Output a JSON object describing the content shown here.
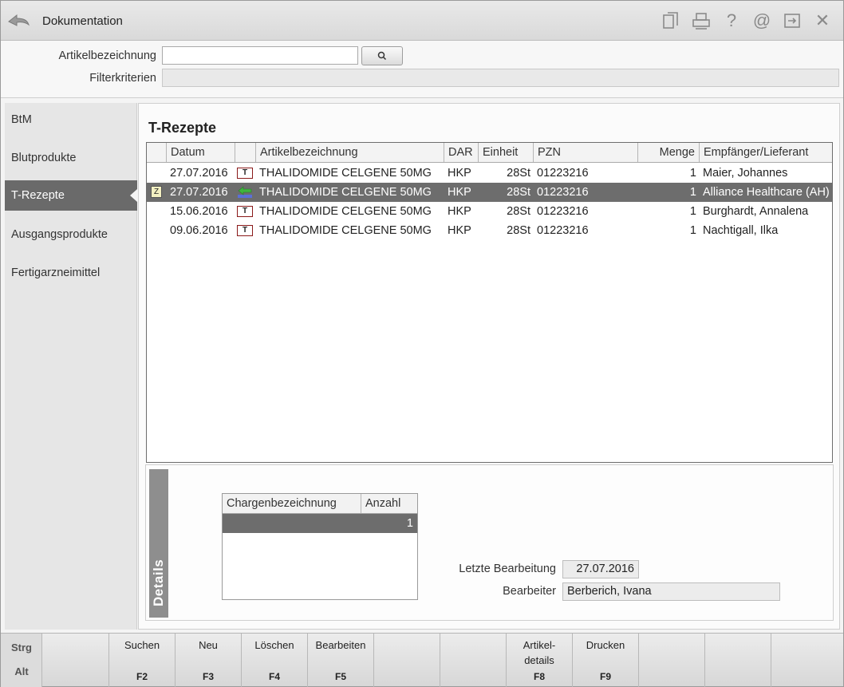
{
  "window": {
    "title": "Dokumentation",
    "toolbar_icons": [
      "copy-icon",
      "print-icon",
      "help-icon",
      "email-icon",
      "exit-icon",
      "close-icon"
    ]
  },
  "search": {
    "article_label": "Artikelbezeichnung",
    "article_value": "",
    "filter_label": "Filterkriterien",
    "filter_value": ""
  },
  "sidebar": {
    "items": [
      {
        "label": "BtM",
        "active": false
      },
      {
        "label": "Blutprodukte",
        "active": false
      },
      {
        "label": "T-Rezepte",
        "active": true
      },
      {
        "label": "Ausgangsprodukte",
        "active": false
      },
      {
        "label": "Fertigarzneimittel",
        "active": false
      }
    ]
  },
  "main": {
    "title": "T-Rezepte",
    "columns": [
      "Datum",
      "",
      "Artikelbezeichnung",
      "DAR",
      "Einheit",
      "PZN",
      "Menge",
      "Empfänger/Lieferant"
    ],
    "rows": [
      {
        "datum": "27.07.2016",
        "type": "T",
        "artikel": "THALIDOMIDE CELGENE 50MG",
        "dar": "HKP",
        "einheit": "28St",
        "pzn": "01223216",
        "menge": "1",
        "empfaenger": "Maier, Johannes",
        "selected": false
      },
      {
        "datum": "27.07.2016",
        "type": "swap",
        "artikel": "THALIDOMIDE CELGENE 50MG",
        "dar": "HKP",
        "einheit": "28St",
        "pzn": "01223216",
        "menge": "1",
        "empfaenger": "Alliance Healthcare (AH)",
        "selected": true
      },
      {
        "datum": "15.06.2016",
        "type": "T",
        "artikel": "THALIDOMIDE CELGENE 50MG",
        "dar": "HKP",
        "einheit": "28St",
        "pzn": "01223216",
        "menge": "1",
        "empfaenger": "Burghardt, Annalena",
        "selected": false
      },
      {
        "datum": "09.06.2016",
        "type": "T",
        "artikel": "THALIDOMIDE CELGENE 50MG",
        "dar": "HKP",
        "einheit": "28St",
        "pzn": "01223216",
        "menge": "1",
        "empfaenger": "Nachtigall, Ilka",
        "selected": false
      }
    ]
  },
  "details": {
    "tab_label": "Details",
    "charge_columns": [
      "Chargenbezeichnung",
      "Anzahl"
    ],
    "charge_rows": [
      {
        "bezeichnung": "",
        "anzahl": "1"
      }
    ],
    "last_edit_label": "Letzte Bearbeitung",
    "last_edit_value": "27.07.2016",
    "editor_label": "Bearbeiter",
    "editor_value": "Berberich, Ivana"
  },
  "fkeys": {
    "mod_strg": "Strg",
    "mod_alt": "Alt",
    "keys": [
      {
        "label": "",
        "key": ""
      },
      {
        "label": "Suchen",
        "key": "F2"
      },
      {
        "label": "Neu",
        "key": "F3"
      },
      {
        "label": "Löschen",
        "key": "F4"
      },
      {
        "label": "Bearbeiten",
        "key": "F5"
      },
      {
        "label": "",
        "key": ""
      },
      {
        "label": "",
        "key": ""
      },
      {
        "label": "Artikel-\ndetails",
        "key": "F8"
      },
      {
        "label": "Drucken",
        "key": "F9"
      },
      {
        "label": "",
        "key": ""
      },
      {
        "label": "",
        "key": ""
      },
      {
        "label": "",
        "key": ""
      }
    ]
  }
}
